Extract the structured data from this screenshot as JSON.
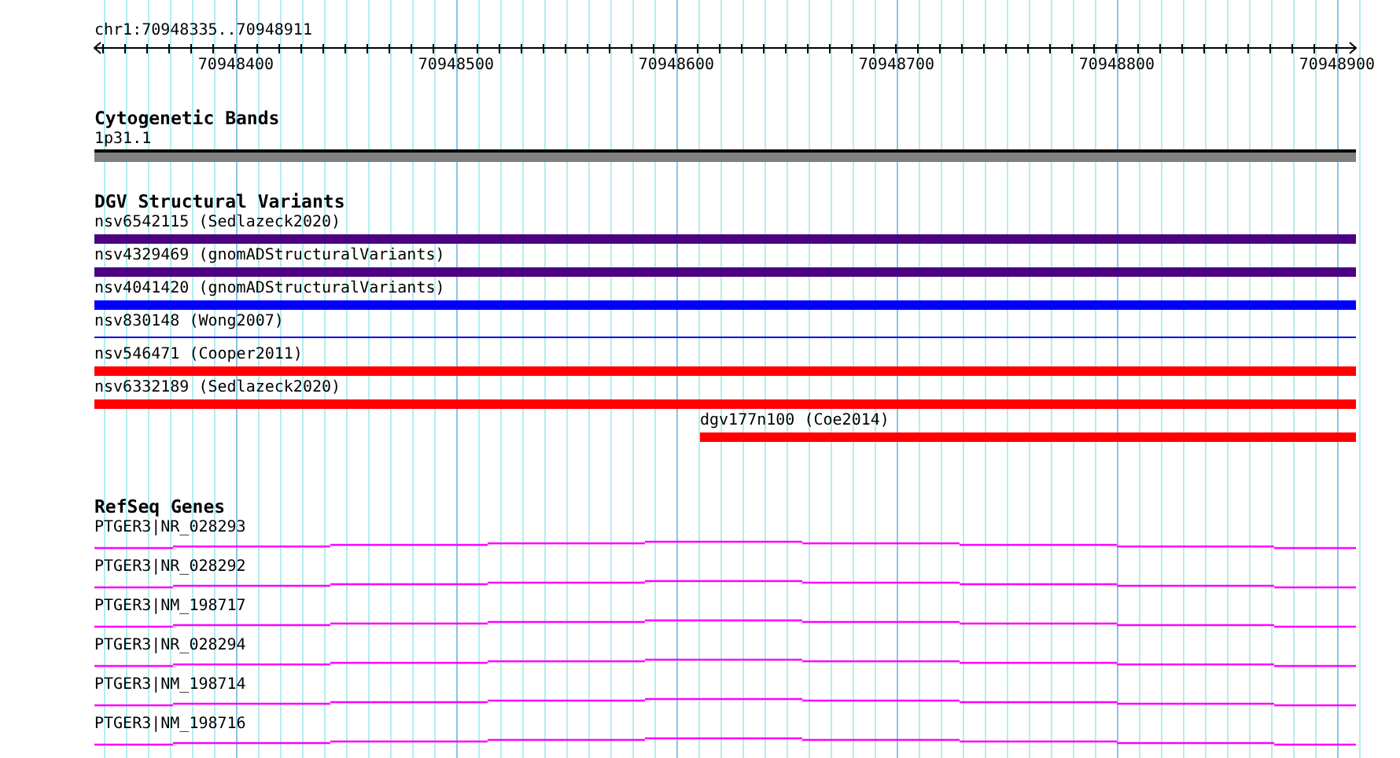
{
  "ruler": {
    "location": "chr1:70948335..70948911",
    "ticks": [
      "70948400",
      "70948500",
      "70948600",
      "70948700",
      "70948800",
      "70948900"
    ]
  },
  "cytobands": {
    "title": "Cytogenetic Bands",
    "band": "1p31.1"
  },
  "variants": {
    "title": "DGV Structural Variants",
    "items": [
      {
        "label": "nsv6542115 (Sedlazeck2020)",
        "kind": "bar",
        "color": "#4b0082",
        "extends_left": true
      },
      {
        "label": "nsv4329469 (gnomADStructuralVariants)",
        "kind": "bar",
        "color": "#4b0082",
        "extends_left": true
      },
      {
        "label": "nsv4041420 (gnomADStructuralVariants)",
        "kind": "bar",
        "color": "#0000ff",
        "extends_left": true
      },
      {
        "label": "nsv830148 (Wong2007)",
        "kind": "line",
        "color": "#0000ff",
        "extends_left": true
      },
      {
        "label": "nsv546471 (Cooper2011)",
        "kind": "bar",
        "color": "#ff0000",
        "extends_left": true
      },
      {
        "label": "nsv6332189 (Sedlazeck2020)",
        "kind": "bar",
        "color": "#ff0000",
        "extends_left": true
      },
      {
        "label": "dgv177n100 (Coe2014)",
        "kind": "bar",
        "color": "#ff0000",
        "extends_left": false
      }
    ]
  },
  "genes": {
    "title": "RefSeq Genes",
    "items": [
      {
        "label": "PTGER3|NR_028293"
      },
      {
        "label": "PTGER3|NR_028292"
      },
      {
        "label": "PTGER3|NM_198717"
      },
      {
        "label": "PTGER3|NR_028294"
      },
      {
        "label": "PTGER3|NM_198714"
      },
      {
        "label": "PTGER3|NM_198716"
      }
    ]
  }
}
